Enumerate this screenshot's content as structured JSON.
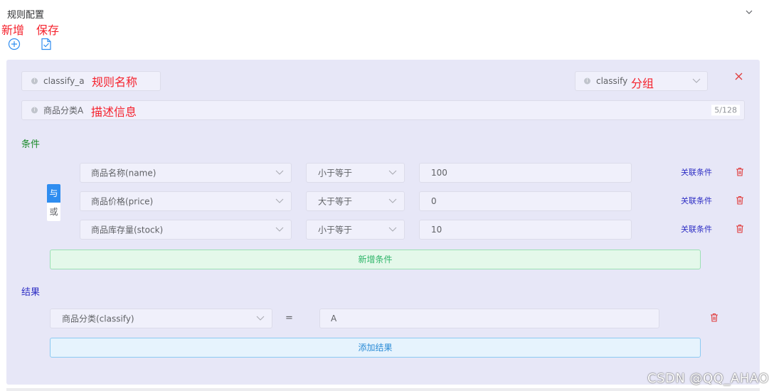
{
  "header": {
    "title": "规则配置"
  },
  "annotations": {
    "add": "新增",
    "save": "保存",
    "rule_name": "规则名称",
    "group": "分组",
    "description": "描述信息"
  },
  "rule": {
    "name_value": "classify_a",
    "group_value": "classify",
    "description_value": "商品分类A",
    "description_counter": "5/128"
  },
  "conditions": {
    "label": "条件",
    "logic_and": "与",
    "logic_or": "或",
    "rows": [
      {
        "field": "商品名称(name)",
        "operator": "小于等于",
        "value": "100",
        "link": "关联条件"
      },
      {
        "field": "商品价格(price)",
        "operator": "大于等于",
        "value": "0",
        "link": "关联条件"
      },
      {
        "field": "商品库存量(stock)",
        "operator": "小于等于",
        "value": "10",
        "link": "关联条件"
      }
    ],
    "add_label": "新增条件"
  },
  "results": {
    "label": "结果",
    "field": "商品分类(classify)",
    "equals": "=",
    "value": "A",
    "add_label": "添加结果"
  },
  "watermark": "CSDN @QQ_AHAO",
  "colors": {
    "condition_label": "#1a8a2a",
    "result_label": "#2d2dc4",
    "annotation": "#f5222d",
    "danger": "#e03a3a",
    "primary": "#2f8df0"
  }
}
